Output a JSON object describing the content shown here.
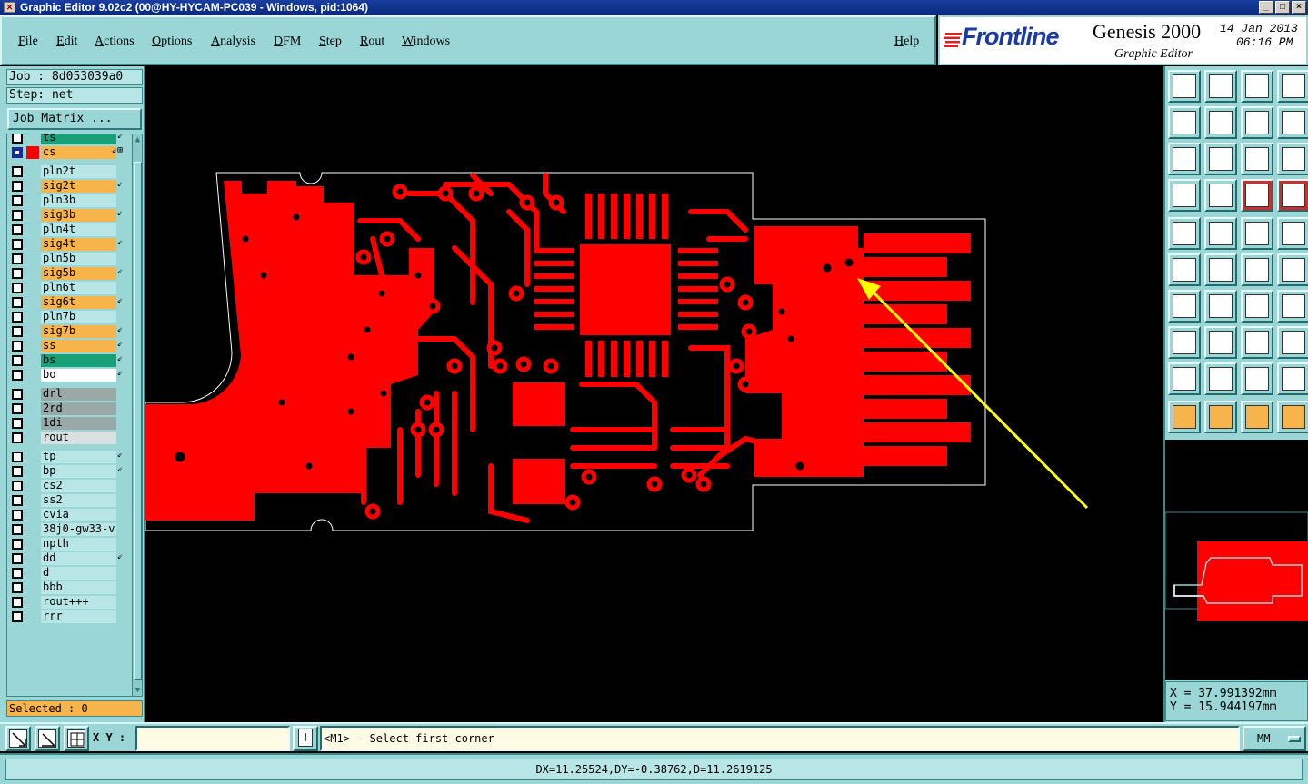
{
  "window": {
    "title": "Graphic Editor 9.02c2 (00@HY-HYCAM-PC039 - Windows, pid:1064)",
    "controls": [
      "_",
      "□",
      "×"
    ]
  },
  "menu": {
    "items": [
      "File",
      "Edit",
      "Actions",
      "Options",
      "Analysis",
      "DFM",
      "Step",
      "Rout",
      "Windows"
    ],
    "help": "Help"
  },
  "brand": {
    "logo": "Frontline",
    "product": "Genesis 2000",
    "subtitle": "Graphic Editor",
    "date": "14 Jan 2013",
    "time": "06:16 PM"
  },
  "left_panel": {
    "job": "Job : 8d053039a0",
    "step": "Step: net",
    "job_matrix_button": "Job Matrix ...",
    "selected": "Selected : 0",
    "layers": [
      {
        "name": "ts",
        "kind": "sm",
        "flag": "⇙"
      },
      {
        "name": "cs",
        "kind": "cs",
        "flag": "⇙⊞",
        "selected": true,
        "color": "#ff0000"
      },
      {
        "name": "pln2t",
        "kind": "plain"
      },
      {
        "name": "sig2t",
        "kind": "sig",
        "flag": "⇙"
      },
      {
        "name": "pln3b",
        "kind": "plain"
      },
      {
        "name": "sig3b",
        "kind": "sig",
        "flag": "⇙"
      },
      {
        "name": "pln4t",
        "kind": "plain"
      },
      {
        "name": "sig4t",
        "kind": "sig",
        "flag": "⇙"
      },
      {
        "name": "pln5b",
        "kind": "plain"
      },
      {
        "name": "sig5b",
        "kind": "sig",
        "flag": "⇙"
      },
      {
        "name": "pln6t",
        "kind": "plain"
      },
      {
        "name": "sig6t",
        "kind": "sig",
        "flag": "⇙"
      },
      {
        "name": "pln7b",
        "kind": "plain"
      },
      {
        "name": "sig7b",
        "kind": "sig",
        "flag": "⇙"
      },
      {
        "name": "ss",
        "kind": "sig",
        "flag": "⇙"
      },
      {
        "name": "bs",
        "kind": "sm",
        "flag": "⇙"
      },
      {
        "name": "bo",
        "kind": "white",
        "flag": "⇙"
      },
      {
        "name": "drl",
        "kind": "gray"
      },
      {
        "name": "2rd",
        "kind": "gray"
      },
      {
        "name": "1di",
        "kind": "gray"
      },
      {
        "name": "rout",
        "kind": "light"
      },
      {
        "name": "tp",
        "kind": "plain",
        "flag": "⇙"
      },
      {
        "name": "bp",
        "kind": "plain",
        "flag": "⇙"
      },
      {
        "name": "cs2",
        "kind": "plain"
      },
      {
        "name": "ss2",
        "kind": "plain"
      },
      {
        "name": "cvia",
        "kind": "plain"
      },
      {
        "name": "38j0-gw33-v",
        "kind": "plain"
      },
      {
        "name": "npth",
        "kind": "plain"
      },
      {
        "name": "dd",
        "kind": "plain",
        "flag": "⇙"
      },
      {
        "name": "d",
        "kind": "plain"
      },
      {
        "name": "bbb",
        "kind": "plain"
      },
      {
        "name": "rout+++",
        "kind": "plain"
      },
      {
        "name": "rrr",
        "kind": "plain"
      }
    ]
  },
  "right_panel": {
    "coord_x": "X = 37.991392mm",
    "coord_y": "Y = 15.944197mm"
  },
  "command_bar": {
    "xy_label": "X Y :",
    "xy_value": "",
    "exclaim": "!",
    "prompt": "<M1> - Select first corner",
    "units": "MM"
  },
  "status": {
    "measure": "DX=11.25524,DY=-0.38762,D=11.2619125"
  },
  "colors": {
    "panel": "#9ad6d6",
    "copper": "#ff0000",
    "arrow": "#ffff00",
    "canvas": "#000000"
  }
}
